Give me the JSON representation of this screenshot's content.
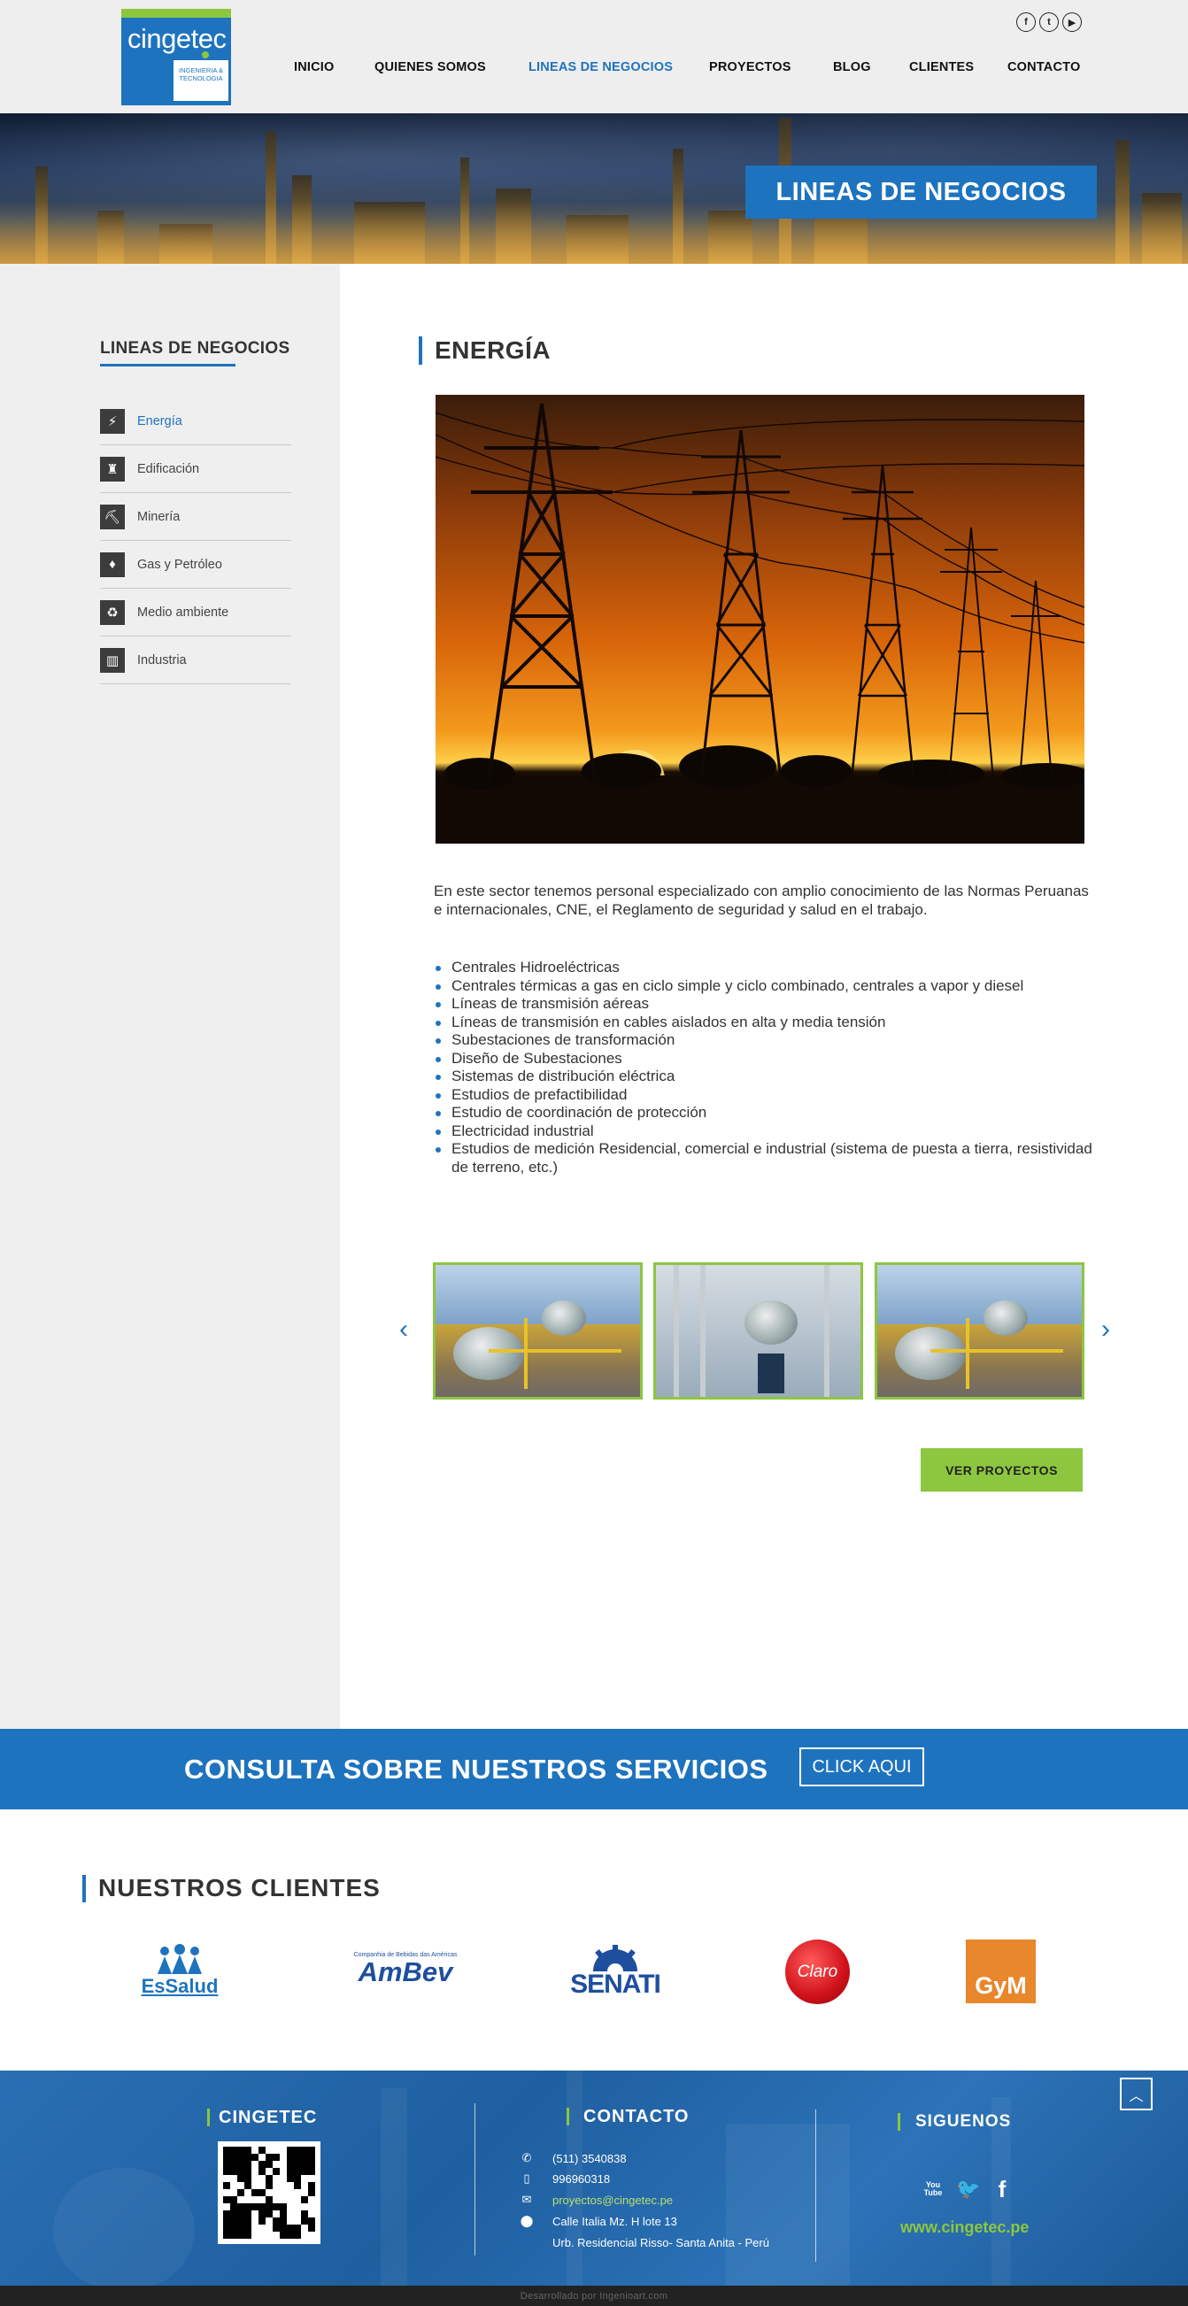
{
  "header": {
    "logo": {
      "name": "cingetec",
      "tagline": "INGENIERIA & TECNOLOGIA"
    },
    "social": [
      "facebook-icon",
      "twitter-icon",
      "youtube-icon"
    ],
    "social_glyphs": [
      "f",
      "t",
      "▶"
    ],
    "nav": [
      {
        "label": "INICIO",
        "active": false
      },
      {
        "label": "QUIENES SOMOS",
        "active": false
      },
      {
        "label": "LINEAS DE NEGOCIOS",
        "active": true
      },
      {
        "label": "PROYECTOS",
        "active": false
      },
      {
        "label": "BLOG",
        "active": false
      },
      {
        "label": "CLIENTES",
        "active": false
      },
      {
        "label": "CONTACTO",
        "active": false
      }
    ]
  },
  "banner": {
    "title": "LINEAS DE NEGOCIOS"
  },
  "sidebar": {
    "title": "LINEAS DE NEGOCIOS",
    "items": [
      {
        "label": "Energía",
        "icon": "lightning-icon",
        "glyph": "⚡",
        "active": true
      },
      {
        "label": "Edificación",
        "icon": "tower-icon",
        "glyph": "♜",
        "active": false
      },
      {
        "label": "Minería",
        "icon": "mining-icon",
        "glyph": "⛏",
        "active": false
      },
      {
        "label": "Gas y Petróleo",
        "icon": "flame-icon",
        "glyph": "♦",
        "active": false
      },
      {
        "label": "Medio ambiente",
        "icon": "truck-icon",
        "glyph": "♻",
        "active": false
      },
      {
        "label": "Industria",
        "icon": "factory-icon",
        "glyph": "▥",
        "active": false
      }
    ]
  },
  "main": {
    "title": "ENERGÍA",
    "intro": "En este sector tenemos personal especializado con amplio conocimiento de las Normas Peruanas e internacionales, CNE, el Reglamento de seguridad y salud en el trabajo.",
    "services": [
      "Centrales Hidroeléctricas",
      "Centrales térmicas a gas en ciclo simple y ciclo combinado, centrales a vapor y diesel",
      "Líneas de transmisión aéreas",
      "Líneas de transmisión en cables aislados en alta y media tensión",
      "Subestaciones de transformación",
      "Diseño de Subestaciones",
      "Sistemas de distribución eléctrica",
      "Estudios de prefactibilidad",
      "Estudio de coordinación de protección",
      "Electricidad industrial",
      "Estudios de medición Residencial, comercial e industrial (sistema de puesta a tierra, resistividad de terreno, etc.)"
    ],
    "carousel": {
      "prev": "‹",
      "next": "›"
    },
    "button": "VER  PROYECTOS"
  },
  "consulta": {
    "text": "CONSULTA SOBRE NUESTROS SERVICIOS",
    "button": "CLICK AQUI"
  },
  "clients": {
    "title": "NUESTROS CLIENTES",
    "logos": [
      {
        "name": "EsSalud"
      },
      {
        "name": "AmBev",
        "sub": "Companhia de Bebidas das Américas"
      },
      {
        "name": "SENATI"
      },
      {
        "name": "Claro"
      },
      {
        "name": "GyM"
      }
    ]
  },
  "footer": {
    "col1_title": "CINGETEC",
    "col2_title": "CONTACTO",
    "col3_title": "SIGUENOS",
    "phone": "(511) 3540838",
    "mobile": "996960318",
    "email": "proyectos@cingetec.pe",
    "address1": "Calle Italia Mz.  H lote 13",
    "address2": "Urb. Residencial Risso- Santa Anita - Perú",
    "social": [
      {
        "icon": "youtube-icon",
        "label": "You Tube"
      },
      {
        "icon": "twitter-icon",
        "label": "🐦"
      },
      {
        "icon": "facebook-icon",
        "label": "f"
      }
    ],
    "url": "www.cingetec.pe",
    "to_top": "︿"
  },
  "credits": "Desarrollado por Ingenioart.com"
}
